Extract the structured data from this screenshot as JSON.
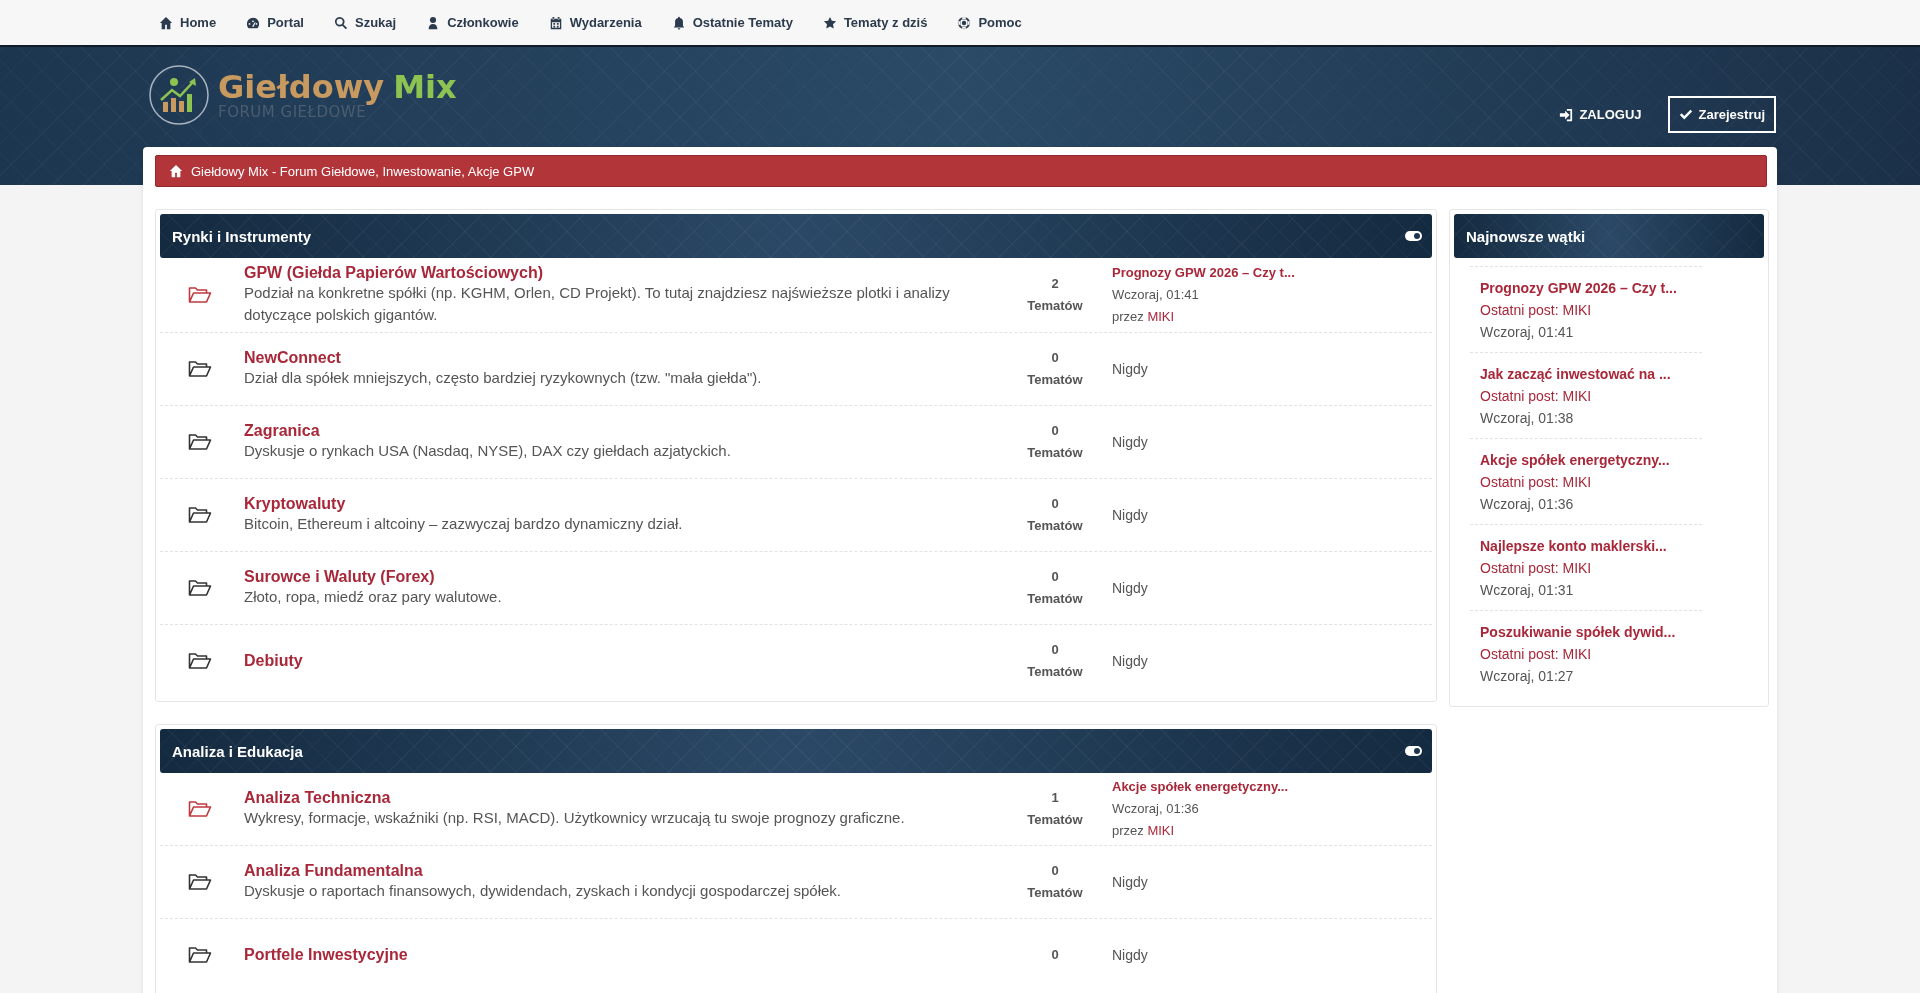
{
  "nav": [
    {
      "label": "Home"
    },
    {
      "label": "Portal"
    },
    {
      "label": "Szukaj"
    },
    {
      "label": "Członkowie"
    },
    {
      "label": "Wydarzenia"
    },
    {
      "label": "Ostatnie Tematy"
    },
    {
      "label": "Tematy z dziś"
    },
    {
      "label": "Pomoc"
    }
  ],
  "logo": {
    "name_part_1": "Giełdowy",
    "name_part_2": "Mix",
    "tagline": "FORUM GIEŁDOWE"
  },
  "auth": {
    "login": "ZALOGUJ",
    "register": "Zarejestruj"
  },
  "breadcrumb": "Giełdowy Mix - Forum Giełdowe, Inwestowanie, Akcje GPW",
  "categories": [
    {
      "title": "Rynki i Instrumenty",
      "expanded": true,
      "forums": [
        {
          "title": "GPW (Giełda Papierów Wartościowych)",
          "description": "Podział na konkretne spółki (np. KGHM, Orlen, CD Projekt). To tutaj znajdziesz najświeższe plotki i analizy dotyczące polskich gigantów.",
          "unread": true,
          "count": "2",
          "count_label": "Tematów",
          "last_post": {
            "title": "Prognozy GPW 2026 – Czy t...",
            "time": "Wczoraj, 01:41",
            "by": "przez",
            "author": "MIKI"
          }
        },
        {
          "title": "NewConnect",
          "description": "Dział dla spółek mniejszych, często bardziej ryzykownych (tzw. \"mała giełda\").",
          "unread": false,
          "count": "0",
          "count_label": "Tematów",
          "never": "Nigdy"
        },
        {
          "title": "Zagranica",
          "description": "Dyskusje o rynkach USA (Nasdaq, NYSE), DAX czy giełdach azjatyckich.",
          "unread": false,
          "count": "0",
          "count_label": "Tematów",
          "never": "Nigdy"
        },
        {
          "title": "Kryptowaluty",
          "description": "Bitcoin, Ethereum i altcoiny – zazwyczaj bardzo dynamiczny dział.",
          "unread": false,
          "count": "0",
          "count_label": "Tematów",
          "never": "Nigdy"
        },
        {
          "title": "Surowce i Waluty (Forex)",
          "description": "Złoto, ropa, miedź oraz pary walutowe.",
          "unread": false,
          "count": "0",
          "count_label": "Tematów",
          "never": "Nigdy"
        },
        {
          "title": "Debiuty",
          "unread": false,
          "count": "0",
          "count_label": "Tematów",
          "never": "Nigdy"
        }
      ]
    },
    {
      "title": "Analiza i Edukacja",
      "expanded": true,
      "forums": [
        {
          "title": "Analiza Techniczna",
          "description": "Wykresy, formacje, wskaźniki (np. RSI, MACD). Użytkownicy wrzucają tu swoje prognozy graficzne.",
          "unread": true,
          "count": "1",
          "count_label": "Tematów",
          "last_post": {
            "title": "Akcje spółek energetyczny...",
            "time": "Wczoraj, 01:36",
            "by": "przez",
            "author": "MIKI"
          }
        },
        {
          "title": "Analiza Fundamentalna",
          "description": "Dyskusje o raportach finansowych, dywidendach, zyskach i kondycji gospodarczej spółek.",
          "unread": false,
          "count": "0",
          "count_label": "Tematów",
          "never": "Nigdy"
        },
        {
          "title": "Portfele Inwestycyjne",
          "unread": false,
          "count": "0",
          "never": "Nigdy"
        }
      ]
    }
  ],
  "sidebar": {
    "title": "Najnowsze wątki",
    "threads": [
      {
        "title": "Prognozy GPW 2026 – Czy t...",
        "last_post": "Ostatni post: MIKI",
        "time": "Wczoraj, 01:41"
      },
      {
        "title": "Jak zacząć inwestować na ...",
        "last_post": "Ostatni post: MIKI",
        "time": "Wczoraj, 01:38"
      },
      {
        "title": "Akcje spółek energetyczny...",
        "last_post": "Ostatni post: MIKI",
        "time": "Wczoraj, 01:36"
      },
      {
        "title": "Najlepsze konto maklerski...",
        "last_post": "Ostatni post: MIKI",
        "time": "Wczoraj, 01:31"
      },
      {
        "title": "Poszukiwanie spółek dywid...",
        "last_post": "Ostatni post: MIKI",
        "time": "Wczoraj, 01:27"
      }
    ]
  }
}
